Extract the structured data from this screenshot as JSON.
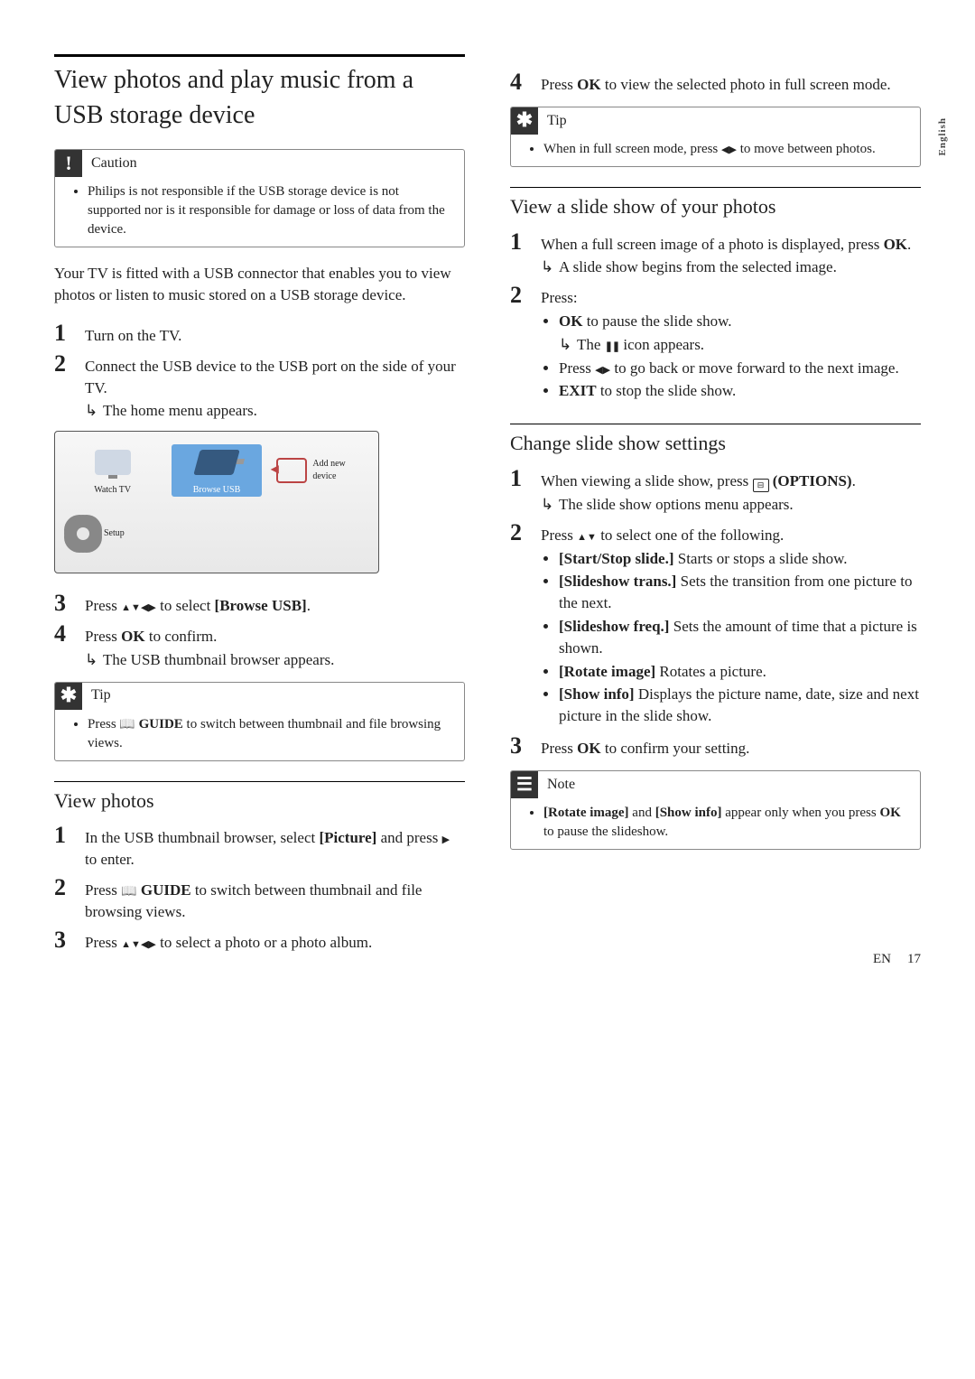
{
  "lang_tab": "English",
  "main_heading": "View photos and play music from a USB storage device",
  "caution": {
    "label": "Caution",
    "item": "Philips is not responsible if the USB storage device is not supported nor is it responsible for damage or loss of data from the device."
  },
  "intro": "Your TV is fitted with a USB connector that enables you to view photos or listen to music stored on a USB storage device.",
  "steps_a": {
    "s1": "Turn on the TV.",
    "s2": "Connect the USB device to the USB port on the side of your TV.",
    "s2_result": "The home menu appears.",
    "s3_pre": "Press ",
    "s3_post": " to select ",
    "s3_target": "[Browse USB]",
    "s3_end": ".",
    "s4_pre": "Press ",
    "s4_key": "OK",
    "s4_post": " to confirm.",
    "s4_result": "The USB thumbnail browser appears."
  },
  "home_menu": {
    "watch_tv": "Watch TV",
    "browse_usb": "Browse USB",
    "add_device": "Add new device",
    "setup": "Setup"
  },
  "tip1": {
    "label": "Tip",
    "pre": "Press ",
    "key": "GUIDE",
    "post": " to switch between thumbnail and file browsing views."
  },
  "view_photos": {
    "heading": "View photos",
    "s1_pre": "In the USB thumbnail browser, select ",
    "s1_key": "[Picture]",
    "s1_mid": " and press ",
    "s1_post": " to enter.",
    "s2_pre": "Press ",
    "s2_key": "GUIDE",
    "s2_post": " to switch between thumbnail and file browsing views.",
    "s3_pre": "Press ",
    "s3_post": " to select a photo or a photo album.",
    "s4_pre": "Press ",
    "s4_key": "OK",
    "s4_post": " to view the selected photo in full screen mode."
  },
  "tip2": {
    "label": "Tip",
    "pre": "When in full screen mode, press ",
    "post": " to move between photos."
  },
  "slideshow": {
    "heading": "View a slide show of your photos",
    "s1_pre": "When a full screen image of a photo is displayed, press ",
    "s1_key": "OK",
    "s1_end": ".",
    "s1_result": "A slide show begins from the selected image.",
    "s2": "Press:",
    "s2_b1_key": "OK",
    "s2_b1_post": " to pause the slide show.",
    "s2_b1_result_pre": "The ",
    "s2_b1_result_post": " icon appears.",
    "s2_b2_pre": "Press ",
    "s2_b2_post": " to go back or move forward to the next image.",
    "s2_b3_key": "EXIT",
    "s2_b3_post": " to stop the slide show."
  },
  "settings": {
    "heading": "Change slide show settings",
    "s1_pre": "When viewing a slide show, press ",
    "s1_key": "(OPTIONS)",
    "s1_end": ".",
    "s1_result": "The slide show options menu appears.",
    "s2_pre": "Press ",
    "s2_post": " to select one of the following.",
    "opts": [
      {
        "name": "[Start/Stop slide.]",
        "desc": " Starts or stops a slide show."
      },
      {
        "name": "[Slideshow trans.]",
        "desc": " Sets the transition from one picture to the next."
      },
      {
        "name": "[Slideshow freq.]",
        "desc": " Sets the amount of time that a picture is shown."
      },
      {
        "name": "[Rotate image]",
        "desc": " Rotates a picture."
      },
      {
        "name": "[Show info]",
        "desc": " Displays the picture name, date, size and next picture in the slide show."
      }
    ],
    "s3_pre": "Press ",
    "s3_key": "OK",
    "s3_post": " to confirm your setting."
  },
  "note": {
    "label": "Note",
    "k1": "[Rotate image]",
    "mid": " and ",
    "k2": "[Show info]",
    "post_pre": " appear only when you press ",
    "post_key": "OK",
    "post_end": " to pause the slideshow."
  },
  "footer": {
    "lang": "EN",
    "page": "17"
  }
}
